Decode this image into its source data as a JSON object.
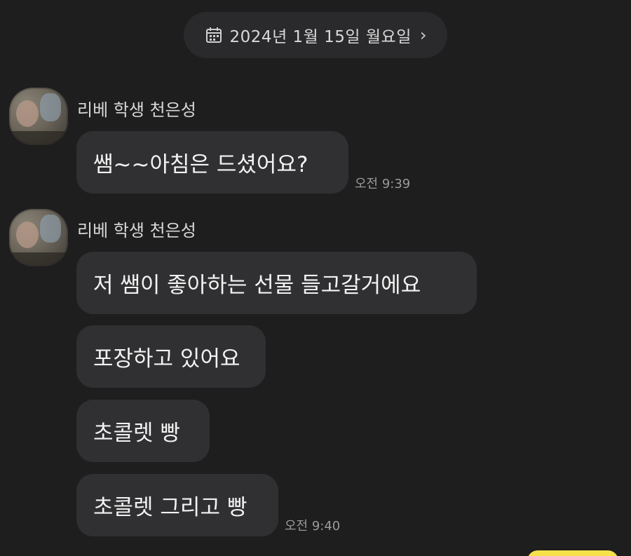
{
  "header": {
    "date_text": "2024년 1월 15일 월요일",
    "calendar_icon": "calendar-icon",
    "chevron_icon": "chevron-right-icon"
  },
  "groups": [
    {
      "sender": "리베 학생 천은성",
      "messages": [
        {
          "text": "쌤~~아침은 드셨어요?"
        }
      ],
      "time": "오전 9:39"
    },
    {
      "sender": "리베 학생 천은성",
      "messages": [
        {
          "text": "저 쌤이 좋아하는 선물 들고갈거에요"
        },
        {
          "text": "포장하고 있어요"
        },
        {
          "text": "초콜렛 빵"
        },
        {
          "text": "초콜렛 그리고 빵"
        }
      ],
      "time": "오전 9:40"
    }
  ],
  "colors": {
    "background": "#1e1e1f",
    "bubble": "#303032",
    "date_pill": "#2a2a2c",
    "my_bubble_accent": "#f7e14b"
  }
}
